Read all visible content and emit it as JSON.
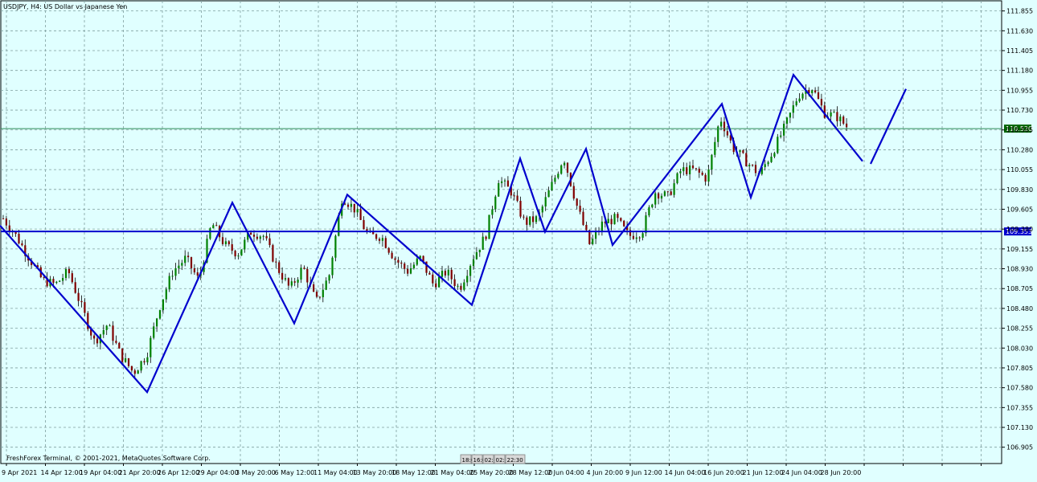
{
  "window": {
    "title": "USDJPY, H4:  US Dollar vs Japanese Yen",
    "footer": "FreshForex Terminal, © 2001-2021, MetaQuotes Software Corp."
  },
  "colors": {
    "background": "#e0ffff",
    "grid": "#7f9f9f",
    "bull_candle": "#008000",
    "bear_candle": "#800000",
    "wick": "#000000",
    "zigzag": "#0000cd",
    "level_line": "#0000cd",
    "bid_line": "#2e8b57",
    "bid_label_bg": "#006400",
    "level_label_bg": "#0000cd"
  },
  "scrollbar_labels": [
    "18:0",
    "16:0",
    "02:",
    "02:",
    "22:30"
  ],
  "chart_data": {
    "type": "candlestick",
    "symbol": "USDJPY",
    "timeframe": "H4",
    "title": "USDJPY, H4:  US Dollar vs Japanese Yen",
    "ylim": [
      106.72,
      111.97
    ],
    "y_ticks": [
      "111.855",
      "111.630",
      "111.405",
      "111.180",
      "110.955",
      "110.730",
      "110.505",
      "110.280",
      "110.055",
      "109.830",
      "109.605",
      "109.380",
      "109.155",
      "108.930",
      "108.705",
      "108.480",
      "108.255",
      "108.030",
      "107.805",
      "107.580",
      "107.355",
      "107.130",
      "106.905"
    ],
    "x_ticks": [
      "9 Apr 2021",
      "14 Apr 12:00",
      "19 Apr 04:00",
      "21 Apr 20:00",
      "26 Apr 12:00",
      "29 Apr 04:00",
      "3 May 20:00",
      "6 May 12:00",
      "11 May 04:00",
      "13 May 20:00",
      "18 May 12:00",
      "21 May 04:00",
      "25 May 20:00",
      "28 May 12:00",
      "2 Jun 04:00",
      "4 Jun 20:00",
      "9 Jun 12:00",
      "14 Jun 04:00",
      "16 Jun 20:00",
      "21 Jun 12:00",
      "24 Jun 04:00",
      "28 Jun 20:00"
    ],
    "bid_price": 110.52,
    "bid_label": "110.520",
    "horizontal_level": 109.353,
    "horizontal_level_label": "109.353",
    "price_path": [
      [
        0,
        109.5
      ],
      [
        10,
        109.3
      ],
      [
        20,
        109.05
      ],
      [
        30,
        108.8
      ],
      [
        40,
        108.75
      ],
      [
        50,
        108.9
      ],
      [
        60,
        108.5
      ],
      [
        70,
        108.1
      ],
      [
        80,
        108.3
      ],
      [
        90,
        107.95
      ],
      [
        100,
        107.75
      ],
      [
        110,
        107.95
      ],
      [
        120,
        108.5
      ],
      [
        130,
        108.9
      ],
      [
        140,
        109.05
      ],
      [
        150,
        108.8
      ],
      [
        160,
        109.45
      ],
      [
        170,
        109.2
      ],
      [
        180,
        109.1
      ],
      [
        190,
        109.35
      ],
      [
        200,
        109.3
      ],
      [
        210,
        108.95
      ],
      [
        220,
        108.7
      ],
      [
        230,
        108.95
      ],
      [
        240,
        108.55
      ],
      [
        250,
        108.85
      ],
      [
        260,
        109.75
      ],
      [
        270,
        109.6
      ],
      [
        280,
        109.3
      ],
      [
        290,
        109.3
      ],
      [
        300,
        109.05
      ],
      [
        310,
        108.9
      ],
      [
        320,
        109.05
      ],
      [
        330,
        108.75
      ],
      [
        340,
        108.9
      ],
      [
        350,
        108.7
      ],
      [
        360,
        109.05
      ],
      [
        370,
        109.3
      ],
      [
        380,
        109.95
      ],
      [
        390,
        109.8
      ],
      [
        400,
        109.45
      ],
      [
        410,
        109.5
      ],
      [
        420,
        109.85
      ],
      [
        430,
        110.2
      ],
      [
        440,
        109.65
      ],
      [
        450,
        109.2
      ],
      [
        460,
        109.45
      ],
      [
        470,
        109.5
      ],
      [
        480,
        109.3
      ],
      [
        490,
        109.35
      ],
      [
        500,
        109.8
      ],
      [
        510,
        109.75
      ],
      [
        520,
        110.05
      ],
      [
        530,
        110.05
      ],
      [
        540,
        109.95
      ],
      [
        550,
        110.65
      ],
      [
        560,
        110.3
      ],
      [
        570,
        110.15
      ],
      [
        580,
        110.0
      ],
      [
        590,
        110.25
      ],
      [
        600,
        110.55
      ],
      [
        610,
        110.9
      ],
      [
        620,
        111.0
      ],
      [
        630,
        110.7
      ],
      [
        640,
        110.65
      ],
      [
        650,
        110.5
      ]
    ],
    "zigzag": [
      [
        0,
        109.42
      ],
      [
        183,
        107.53
      ],
      [
        289,
        109.68
      ],
      [
        366,
        108.31
      ],
      [
        432,
        109.77
      ],
      [
        587,
        108.52
      ],
      [
        647,
        110.18
      ],
      [
        678,
        109.35
      ],
      [
        729,
        110.29
      ],
      [
        762,
        109.2
      ],
      [
        898,
        110.8
      ],
      [
        934,
        109.74
      ],
      [
        987,
        111.13
      ],
      [
        1073,
        110.15
      ]
    ],
    "projection": [
      [
        1083,
        110.12
      ],
      [
        1127,
        110.97
      ]
    ]
  }
}
